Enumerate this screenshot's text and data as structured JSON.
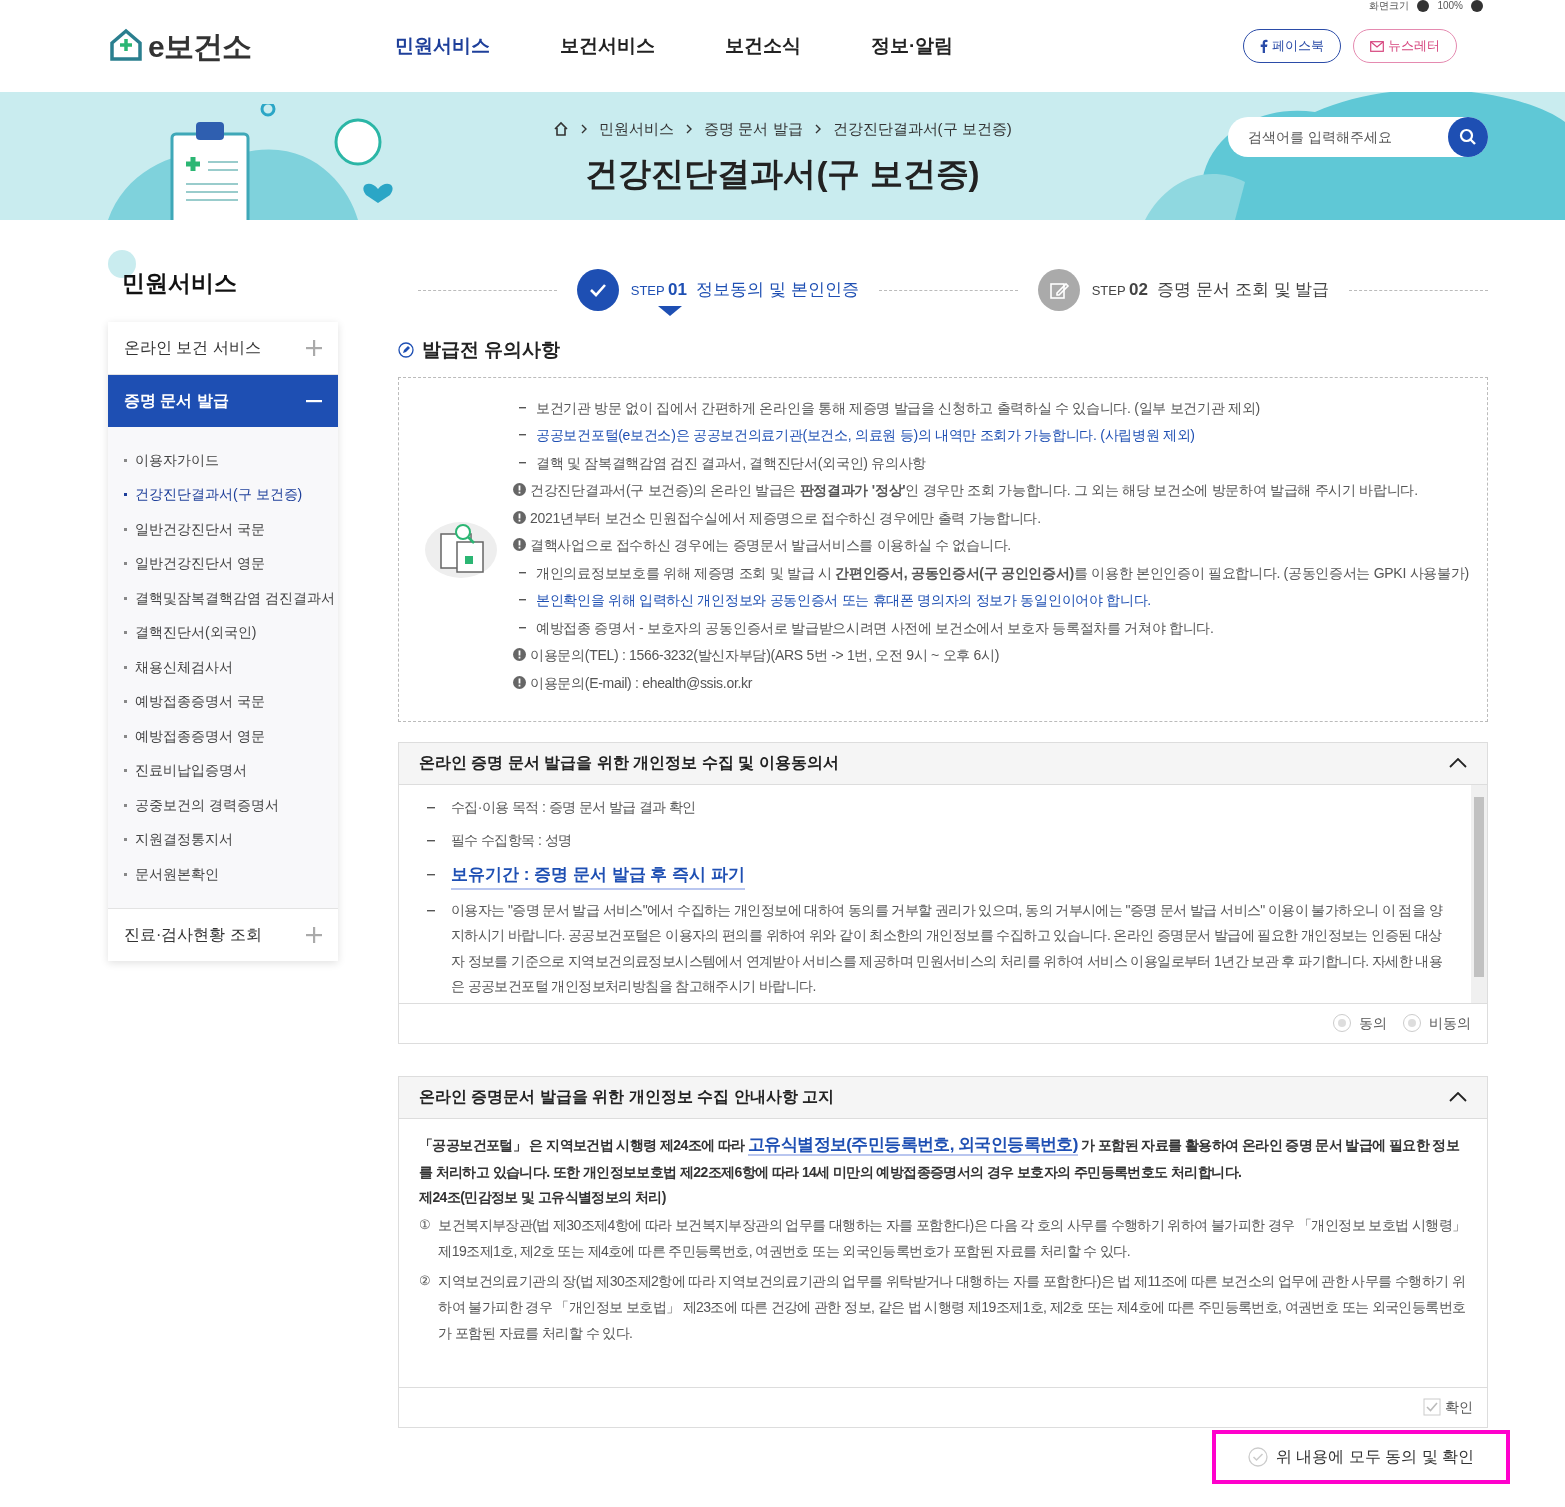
{
  "top_bar": {
    "zoom_label": "화면크기",
    "zoom_value": "100%"
  },
  "header": {
    "logo": "e보건소",
    "nav": [
      {
        "label": "민원서비스",
        "selected": true
      },
      {
        "label": "보건서비스",
        "selected": false
      },
      {
        "label": "보건소식",
        "selected": false
      },
      {
        "label": "정보·알림",
        "selected": false
      }
    ],
    "social": [
      {
        "kind": "facebook",
        "label": "페이스북"
      },
      {
        "kind": "newsletter",
        "label": "뉴스레터"
      }
    ]
  },
  "banner": {
    "breadcrumb": [
      "민원서비스",
      "증명 문서 발급",
      "건강진단결과서(구 보건증)"
    ],
    "title": "건강진단결과서(구 보건증)",
    "search": {
      "placeholder": "검색어를 입력해주세요"
    }
  },
  "sidebar": {
    "title": "민원서비스",
    "groups": [
      {
        "label": "온라인 보건 서비스",
        "expanded": false
      },
      {
        "label": "증명 문서 발급",
        "expanded": true,
        "children": [
          {
            "label": "이용자가이드",
            "selected": false
          },
          {
            "label": "건강진단결과서(구 보건증)",
            "selected": true
          },
          {
            "label": "일반건강진단서 국문",
            "selected": false
          },
          {
            "label": "일반건강진단서 영문",
            "selected": false
          },
          {
            "label": "결핵및잠복결핵감염 검진결과서",
            "selected": false
          },
          {
            "label": "결핵진단서(외국인)",
            "selected": false
          },
          {
            "label": "채용신체검사서",
            "selected": false
          },
          {
            "label": "예방접종증명서 국문",
            "selected": false
          },
          {
            "label": "예방접종증명서 영문",
            "selected": false
          },
          {
            "label": "진료비납입증명서",
            "selected": false
          },
          {
            "label": "공중보건의 경력증명서",
            "selected": false
          },
          {
            "label": "지원결정통지서",
            "selected": false
          },
          {
            "label": "문서원본확인",
            "selected": false
          }
        ]
      },
      {
        "label": "진료·검사현황 조회",
        "expanded": false
      }
    ]
  },
  "steps": [
    {
      "prefix": "STEP",
      "number": "01",
      "label": "정보동의 및 본인인증",
      "selected": true
    },
    {
      "prefix": "STEP",
      "number": "02",
      "label": "증명 문서 조회 및 발급",
      "selected": false
    }
  ],
  "notice": {
    "title": "발급전 유의사항",
    "items": [
      {
        "kind": "dash",
        "highlight": false,
        "text": "보건기관 방문 없이 집에서 간편하게 온라인을 통해 제증명 발급을 신청하고 출력하실 수 있습니다. (일부 보건기관 제외)"
      },
      {
        "kind": "dash",
        "highlight": true,
        "text": "공공보건포털(e보건소)은 공공보건의료기관(보건소, 의료원 등)의 내역만 조회가 가능합니다. (사립병원 제외)"
      },
      {
        "kind": "dash",
        "highlight": false,
        "text": "결핵 및 잠복결핵감염 검진 결과서, 결핵진단서(외국인) 유의사항"
      },
      {
        "kind": "alert",
        "highlight": false,
        "text": "건강진단결과서(구 보건증)의 온라인 발급은 **판정결과가 '정상'**인 경우만 조회 가능합니다. 그 외는 해당 보건소에 방문하여 발급해 주시기 바랍니다."
      },
      {
        "kind": "alert",
        "highlight": false,
        "text": "2021년부터 보건소 민원접수실에서 제증명으로 접수하신 경우에만 출력 가능합니다."
      },
      {
        "kind": "alert",
        "highlight": false,
        "text": "결핵사업으로 접수하신 경우에는 증명문서 발급서비스를 이용하실 수 없습니다."
      },
      {
        "kind": "dash",
        "highlight": false,
        "text": "개인의료정보보호를 위해 제증명 조회 및 발급 시 **간편인증서, 공동인증서(구 공인인증서)**를 이용한 본인인증이 필요합니다. (공동인증서는 GPKI 사용불가)"
      },
      {
        "kind": "dash",
        "highlight": true,
        "text": "본인확인을 위해 입력하신 개인정보와 공동인증서 또는 휴대폰 명의자의 정보가 동일인이어야 합니다."
      },
      {
        "kind": "dash",
        "highlight": false,
        "text": "예방접종 증명서 - 보호자의 공동인증서로 발급받으시려면 사전에 보건소에서 보호자 등록절차를 거쳐야 합니다."
      },
      {
        "kind": "alert",
        "highlight": false,
        "text": "이용문의(TEL) : 1566-3232(발신자부담)(ARS 5번 -> 1번, 오전 9시 ~ 오후 6시)"
      },
      {
        "kind": "alert",
        "highlight": false,
        "text": "이용문의(E-mail) : ehealth@ssis.or.kr"
      }
    ]
  },
  "consent": {
    "title": "온라인 증명 문서 발급을 위한 개인정보 수집 및 이용동의서",
    "expanded": true,
    "items": [
      {
        "kind": "plain",
        "text": "수집·이용 목적 : 증명 문서 발급 결과 확인"
      },
      {
        "kind": "plain",
        "text": "필수 수집항목 : 성명"
      },
      {
        "kind": "emphasis",
        "text": "보유기간 : 증명 문서 발급 후 즉시 파기"
      },
      {
        "kind": "plain",
        "text": "이용자는 \"증명 문서 발급 서비스\"에서 수집하는 개인정보에 대하여 동의를 거부할 권리가 있으며, 동의 거부시에는 \"증명 문서 발급 서비스\" 이용이 불가하오니 이 점을 양지하시기 바랍니다. 공공보건포털은 이용자의 편의를 위하여 위와 같이 최소한의 개인정보를 수집하고 있습니다. 온라인 증명문서 발급에 필요한 개인정보는 인증된 대상자 정보를 기준으로 지역보건의료정보시스템에서 연계받아 서비스를 제공하며 민원서비스의 처리를 위하여 서비스 이용일로부터 1년간 보관 후 파기합니다. 자세한 내용은 공공보건포털 개인정보처리방침을 참고해주시기 바랍니다."
      }
    ],
    "options": [
      {
        "label": "동의",
        "selected": false
      },
      {
        "label": "비동의",
        "selected": false
      }
    ]
  },
  "notification": {
    "title": "온라인 증명문서 발급을 위한 개인정보 수집 안내사항 고지",
    "expanded": true,
    "intro_before": "「공공보건포털」 은 지역보건법 시행령 제24조에 따라",
    "intro_link": "고유식별정보(주민등록번호, 외국인등록번호)",
    "intro_after": "가 포함된 자료를 활용하여 온라인 증명 문서 발급에 필요한 정보를 처리하고 있습니다. 또한 개인정보보호법 제22조제6항에 따라 14세 미만의 예방접종증명서의 경우 보호자의 주민등록번호도 처리합니다.",
    "article": "제24조(민감정보 및 고유식별정보의 처리)",
    "clauses": [
      {
        "mark": "①",
        "text": "보건복지부장관(법 제30조제4항에 따라 보건복지부장관의 업무를 대행하는 자를 포함한다)은 다음 각 호의 사무를 수행하기 위하여 불가피한 경우 「개인정보 보호법 시행령」 제19조제1호, 제2호 또는 제4호에 따른 주민등록번호, 여권번호 또는 외국인등록번호가 포함된 자료를 처리할 수 있다."
      },
      {
        "mark": "②",
        "text": "지역보건의료기관의 장(법 제30조제2항에 따라 지역보건의료기관의 업무를 위탁받거나 대행하는 자를 포함한다)은 법 제11조에 따른 보건소의 업무에 관한 사무를 수행하기 위하여 불가피한 경우 「개인정보 보호법」 제23조에 따른 건강에 관한 정보, 같은 법 시행령 제19조제1호, 제2호 또는 제4호에 따른 주민등록번호, 여권번호 또는 외국인등록번호가 포함된 자료를 처리할 수 있다."
      }
    ],
    "confirm": {
      "label": "확인",
      "checked": false
    }
  },
  "agree_all": {
    "label": "위 내용에 모두 동의 및 확인",
    "checked": false
  }
}
